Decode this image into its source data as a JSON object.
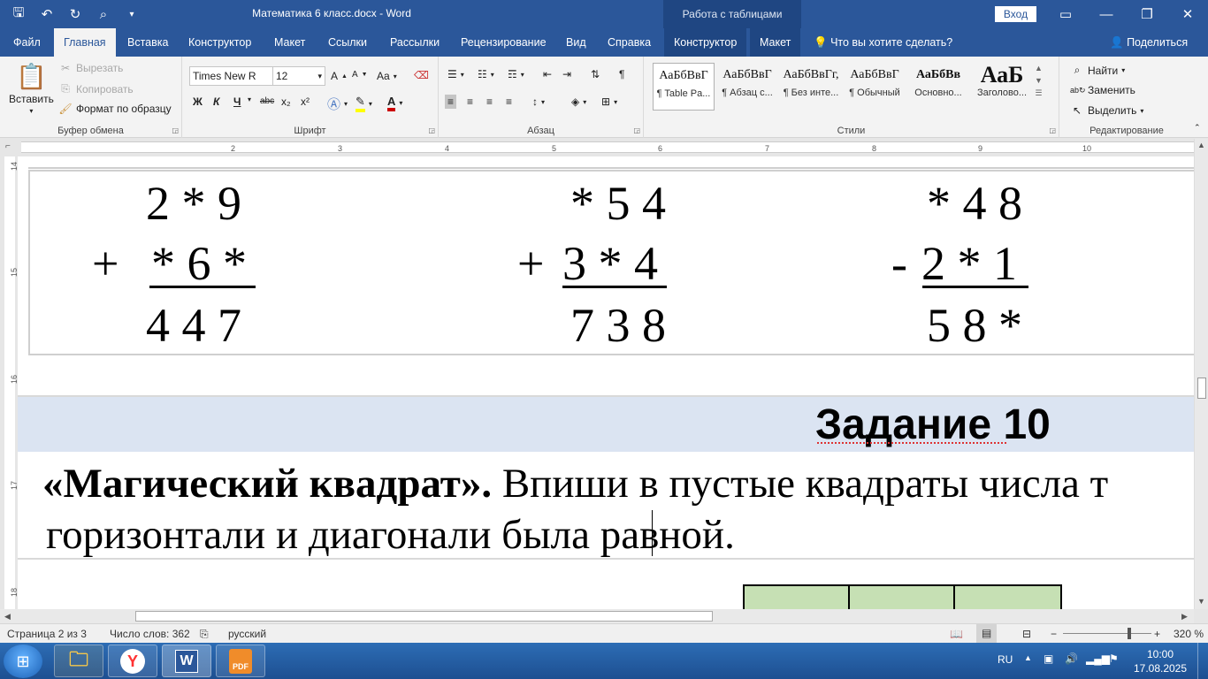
{
  "app": {
    "doc_title": "Математика 6 класс.docx  -  Word",
    "table_tools_label": "Работа с таблицами",
    "signin_label": "Вход"
  },
  "tabs": [
    {
      "label": "Файл"
    },
    {
      "label": "Главная"
    },
    {
      "label": "Вставка"
    },
    {
      "label": "Конструктор"
    },
    {
      "label": "Макет"
    },
    {
      "label": "Ссылки"
    },
    {
      "label": "Рассылки"
    },
    {
      "label": "Рецензирование"
    },
    {
      "label": "Вид"
    },
    {
      "label": "Справка"
    },
    {
      "label": "Конструктор"
    },
    {
      "label": "Макет"
    }
  ],
  "tell_me": "Что вы хотите сделать?",
  "share_label": "Поделиться",
  "ribbon": {
    "clipboard": {
      "label": "Буфер обмена",
      "paste": "Вставить",
      "cut": "Вырезать",
      "copy": "Копировать",
      "format_painter": "Формат по образцу"
    },
    "font": {
      "label": "Шрифт",
      "font_name": "Times New R",
      "font_size": "12",
      "bold": "Ж",
      "italic": "К",
      "underline": "Ч",
      "strike": "abc",
      "subscript": "x₂",
      "superscript": "x²",
      "change_case": "Aa",
      "grow": "A",
      "shrink": "A"
    },
    "paragraph": {
      "label": "Абзац"
    },
    "styles": {
      "label": "Стили",
      "items": [
        {
          "preview": "АаБбВвГ",
          "name": "¶ Table Pa..."
        },
        {
          "preview": "АаБбВвГ",
          "name": "¶ Абзац с..."
        },
        {
          "preview": "АаБбВвГг,",
          "name": "¶ Без инте..."
        },
        {
          "preview": "АаБбВвГ",
          "name": "¶ Обычный"
        },
        {
          "preview": "АаБбВв",
          "name": "Основно..."
        },
        {
          "preview": "АаБ",
          "name": "Заголово..."
        }
      ]
    },
    "editing": {
      "label": "Редактирование",
      "find": "Найти",
      "replace": "Заменить",
      "select": "Выделить"
    }
  },
  "ruler_numbers": [
    "2",
    "3",
    "4",
    "5",
    "6",
    "7",
    "8",
    "9",
    "10"
  ],
  "vruler_numbers": [
    "14",
    "15",
    "16",
    "17",
    "18"
  ],
  "document": {
    "problems": [
      {
        "row1": "2 * 9",
        "op": "+",
        "row2": "* 6 *",
        "result": "4 4 7"
      },
      {
        "row1": "* 5 4",
        "op": "+",
        "row2": "3 * 4",
        "result": "7 3 8"
      },
      {
        "row1": "* 4 8",
        "op": "-",
        "row2": "2 * 1",
        "result": "5 8 *"
      }
    ],
    "task_title": "Задание 10",
    "para_bold": "«Магический квадрат».",
    "para_text1": " Впиши в пустые квадраты числа т",
    "para_text2": "горизонтали и диагонали была равной."
  },
  "status": {
    "page": "Страница 2 из 3",
    "words": "Число слов: 362",
    "language": "русский",
    "zoom": "320 %"
  },
  "taskbar": {
    "lang": "RU",
    "time": "10:00",
    "date": "17.08.2025"
  }
}
